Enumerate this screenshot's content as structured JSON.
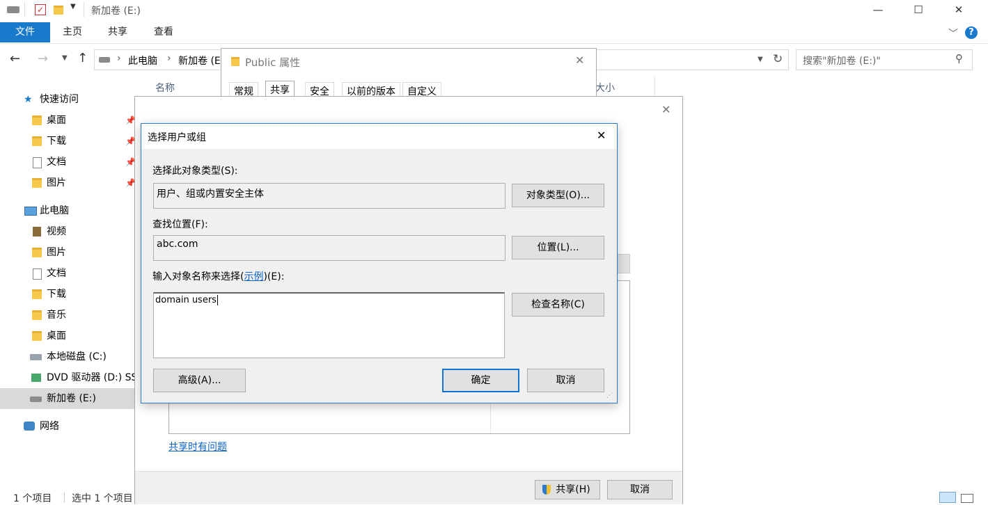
{
  "window": {
    "title": "新加卷 (E:)",
    "controls": {
      "minimize": "—",
      "maximize": "☐",
      "close": "✕"
    }
  },
  "ribbon": {
    "tabs": [
      "文件",
      "主页",
      "共享",
      "查看"
    ],
    "help": "?"
  },
  "address": {
    "path": [
      "此电脑",
      "新加卷 (E:)"
    ],
    "path_visible": [
      "此电脑",
      "新加卷 (E"
    ],
    "search_placeholder": "搜索\"新加卷 (E:)\""
  },
  "content": {
    "col_name": "名称",
    "col_size": "大小"
  },
  "sidebar": {
    "quick_access": "快速访问",
    "quick_items": [
      "桌面",
      "下载",
      "文档",
      "图片"
    ],
    "this_pc": "此电脑",
    "pc_items": [
      "视频",
      "图片",
      "文档",
      "下载",
      "音乐",
      "桌面"
    ],
    "drives": [
      "本地磁盘 (C:)",
      "DVD 驱动器 (D:) SS",
      "新加卷 (E:)"
    ],
    "network": "网络"
  },
  "status": {
    "count": "1 个项目",
    "selected": "选中 1 个项目"
  },
  "props_dialog": {
    "title": "Public 属性",
    "tabs": [
      "常规",
      "共享",
      "安全",
      "以前的版本",
      "自定义"
    ]
  },
  "share_dialog": {
    "problem_link": "共享时有问题",
    "share_button": "共享(H)",
    "cancel_button": "取消"
  },
  "select_dialog": {
    "title": "选择用户或组",
    "object_type_label": "选择此对象类型(S):",
    "object_type_value": "用户、组或内置安全主体",
    "object_type_button": "对象类型(O)...",
    "location_label": "查找位置(F):",
    "location_value": "abc.com",
    "location_button": "位置(L)...",
    "enter_label_prefix": "输入对象名称来选择(",
    "enter_label_link": "示例",
    "enter_label_suffix": ")(E):",
    "enter_value": "domain users",
    "check_button": "检查名称(C)",
    "advanced_button": "高级(A)...",
    "ok_button": "确定",
    "cancel_button": "取消"
  }
}
